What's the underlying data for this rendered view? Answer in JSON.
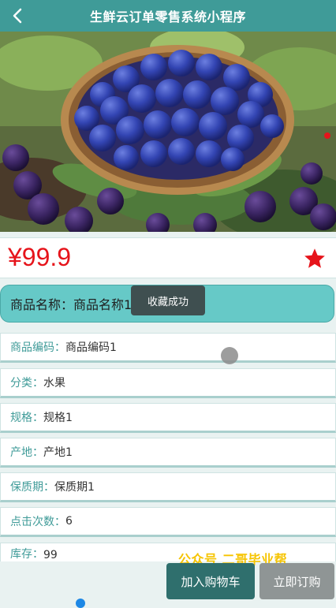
{
  "header": {
    "title": "生鲜云订单零售系统小程序",
    "back_icon": "chevron-left-icon"
  },
  "product": {
    "price": "¥99.9",
    "name_label": "商品名称：",
    "name_value": "商品名称1",
    "favorite_icon": "star-icon",
    "favorite_color": "#e6141b"
  },
  "toast": {
    "text": "收藏成功"
  },
  "details": [
    {
      "label": "商品编码：",
      "value": "商品编码1"
    },
    {
      "label": "分类：",
      "value": "水果"
    },
    {
      "label": "规格：",
      "value": "规格1"
    },
    {
      "label": "产地：",
      "value": "产地1"
    },
    {
      "label": "保质期：",
      "value": "保质期1"
    },
    {
      "label": "点击次数：",
      "value": "6"
    },
    {
      "label": "库存：",
      "value": "99"
    }
  ],
  "watermark": "公众号 二哥毕业帮",
  "actions": {
    "add_to_cart": "加入购物车",
    "order_now": "立即订购"
  },
  "colors": {
    "brand": "#3f9b98",
    "name_card": "#66c9c7",
    "price": "#e6141b",
    "cart_button": "#2f6f6d",
    "order_button": "#8f9595",
    "watermark": "#f6c400"
  }
}
